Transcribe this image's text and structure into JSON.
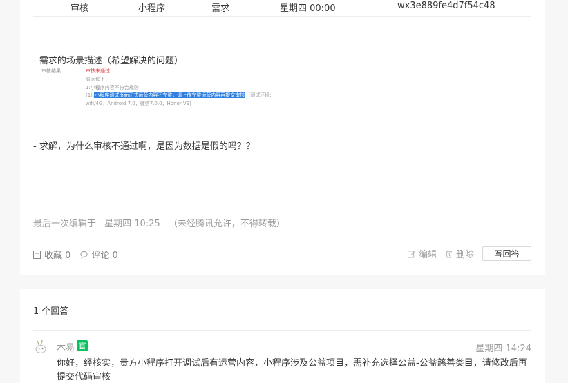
{
  "table_row": {
    "col1": "审核",
    "col2": "小程序",
    "col3": "需求",
    "col4": "星期四 00:00",
    "col5": "wx3e889fe4d7f54c48"
  },
  "scene_heading": "- 需求的场景描述（希望解决的问题）",
  "screenshot": {
    "label": "审核结果",
    "status": "审核未通过",
    "reason_title": "原因如下：",
    "line1": "1:小程序内容不符合规则",
    "line2_prefix": "(1):",
    "line2_highlight": "小程序测试页面正式运营内容不完整，请上传完整运营内容再提交审核",
    "line2_suffix": "（测试环境:",
    "line3": "wifi/4G，Android 7.0，微信7.0.0，Honor V9)"
  },
  "question": "- 求解，为什么审核不通过啊，是因为数据是假的吗？？",
  "meta": {
    "edited_label": "最后一次编辑于",
    "edited_time": "星期四 10:25",
    "copyright": "（未经腾讯允许，不得转载）"
  },
  "actions": {
    "favorite": "收藏 0",
    "comment": "评论 0",
    "edit": "编辑",
    "delete": "删除",
    "write_answer": "写回答"
  },
  "answers": {
    "count_label": "1 个回答",
    "items": [
      {
        "author": "木易",
        "badge": "官",
        "time": "星期四 14:24",
        "text": "你好，经核实，贵方小程序打开调试后有运营内容，小程序涉及公益项目，需补充选择公益-公益慈善类目，请修改后再提交代码审核"
      }
    ]
  },
  "colors": {
    "official_badge": "#07c160",
    "highlight": "#2f7fe0",
    "reject_red": "#e64340"
  }
}
